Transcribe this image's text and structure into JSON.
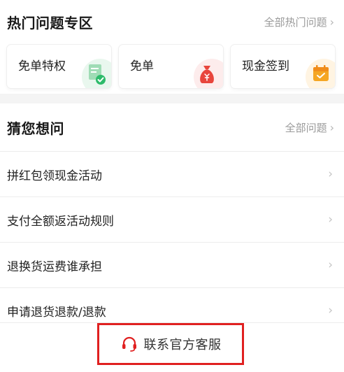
{
  "hot": {
    "title": "热门问题专区",
    "more_label": "全部热门问题",
    "cards": [
      {
        "label": "免单特权",
        "icon": "document-check-icon"
      },
      {
        "label": "免单",
        "icon": "money-bag-icon"
      },
      {
        "label": "现金签到",
        "icon": "calendar-check-icon"
      }
    ]
  },
  "guess": {
    "title": "猜您想问",
    "more_label": "全部问题",
    "questions": [
      "拼红包领现金活动",
      "支付全额返活动规则",
      "退换货运费谁承担",
      "申请退货退款/退款"
    ]
  },
  "footer": {
    "contact_label": "联系官方客服"
  },
  "colors": {
    "accent_red": "#e02020",
    "money_red": "#e8453c",
    "check_green": "#2dbb6a",
    "calendar_orange": "#f5a623"
  }
}
